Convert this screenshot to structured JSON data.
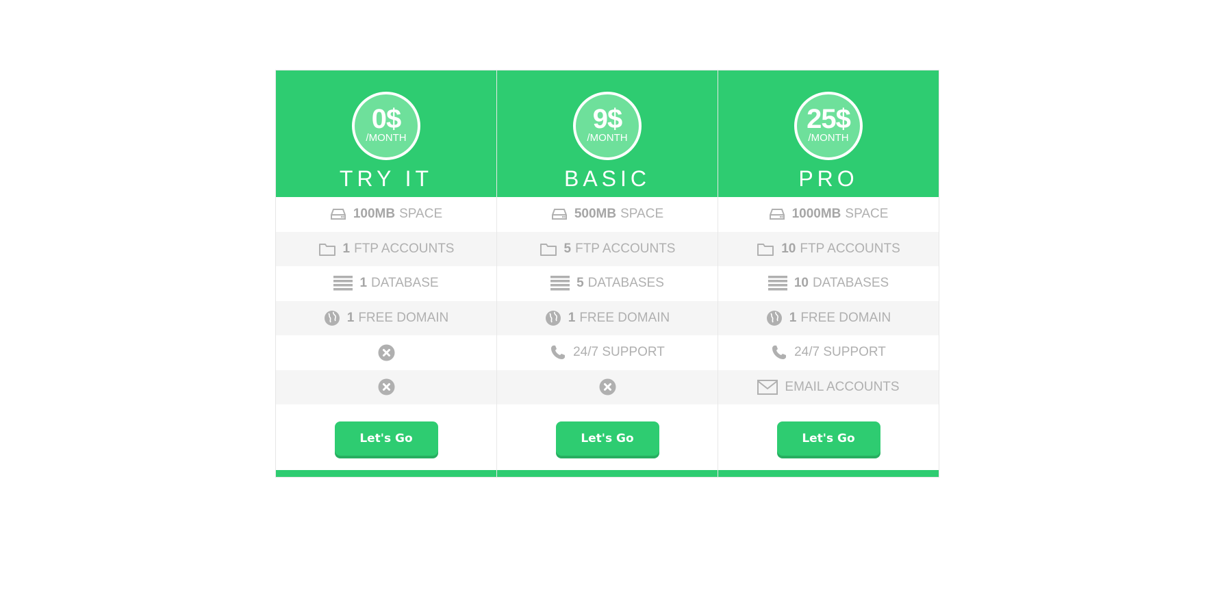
{
  "theme": {
    "accent": "#2ecc71",
    "accent_dark": "#27ae60",
    "circle_fill": "#6ee09b",
    "feature_text": "#b0b0b0",
    "row_alt": "#f5f5f5"
  },
  "plans": [
    {
      "price": "0$",
      "period": "/MONTH",
      "name": "TRY IT",
      "features": [
        {
          "icon": "hard-drive-icon",
          "bold": "100MB",
          "text": "SPACE"
        },
        {
          "icon": "folder-icon",
          "bold": "1",
          "text": "FTP ACCOUNTS"
        },
        {
          "icon": "database-icon",
          "bold": "1",
          "text": "DATABASE"
        },
        {
          "icon": "globe-icon",
          "bold": "1",
          "text": "FREE DOMAIN"
        },
        {
          "icon": "x-circle-icon",
          "bold": "",
          "text": ""
        },
        {
          "icon": "x-circle-icon",
          "bold": "",
          "text": ""
        }
      ],
      "cta": "Let's Go"
    },
    {
      "price": "9$",
      "period": "/MONTH",
      "name": "BASIC",
      "features": [
        {
          "icon": "hard-drive-icon",
          "bold": "500MB",
          "text": "SPACE"
        },
        {
          "icon": "folder-icon",
          "bold": "5",
          "text": "FTP ACCOUNTS"
        },
        {
          "icon": "database-icon",
          "bold": "5",
          "text": "DATABASES"
        },
        {
          "icon": "globe-icon",
          "bold": "1",
          "text": "FREE DOMAIN"
        },
        {
          "icon": "phone-icon",
          "bold": "",
          "text": "24/7 SUPPORT"
        },
        {
          "icon": "x-circle-icon",
          "bold": "",
          "text": ""
        }
      ],
      "cta": "Let's Go"
    },
    {
      "price": "25$",
      "period": "/MONTH",
      "name": "PRO",
      "features": [
        {
          "icon": "hard-drive-icon",
          "bold": "1000MB",
          "text": "SPACE"
        },
        {
          "icon": "folder-icon",
          "bold": "10",
          "text": "FTP ACCOUNTS"
        },
        {
          "icon": "database-icon",
          "bold": "10",
          "text": "DATABASES"
        },
        {
          "icon": "globe-icon",
          "bold": "1",
          "text": "FREE DOMAIN"
        },
        {
          "icon": "phone-icon",
          "bold": "",
          "text": "24/7 SUPPORT"
        },
        {
          "icon": "envelope-icon",
          "bold": "",
          "text": "EMAIL ACCOUNTS"
        }
      ],
      "cta": "Let's Go"
    }
  ]
}
